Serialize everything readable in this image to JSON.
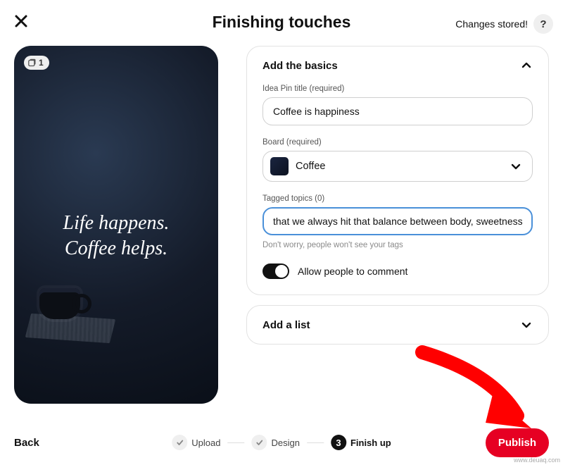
{
  "header": {
    "title": "Finishing touches",
    "status": "Changes stored!",
    "help": "?"
  },
  "preview": {
    "badge_count": "1",
    "line1": "Life happens.",
    "line2": "Coffee helps."
  },
  "panel_basics": {
    "title": "Add the basics",
    "title_field": {
      "label": "Idea Pin title (required)",
      "value": "Coffee is happiness"
    },
    "board_field": {
      "label": "Board (required)",
      "selected": "Coffee"
    },
    "topics_field": {
      "label": "Tagged topics (0)",
      "value": "that we always hit that balance between body, sweetness, and acidity.",
      "hint": "Don't worry, people won't see your tags"
    },
    "comment_toggle": {
      "label": "Allow people to comment",
      "on": true
    }
  },
  "panel_list": {
    "title": "Add a list"
  },
  "footer": {
    "back": "Back",
    "steps": {
      "s1": "Upload",
      "s2": "Design",
      "s3_num": "3",
      "s3": "Finish up"
    },
    "publish": "Publish"
  },
  "watermark": "www.deuaq.com"
}
